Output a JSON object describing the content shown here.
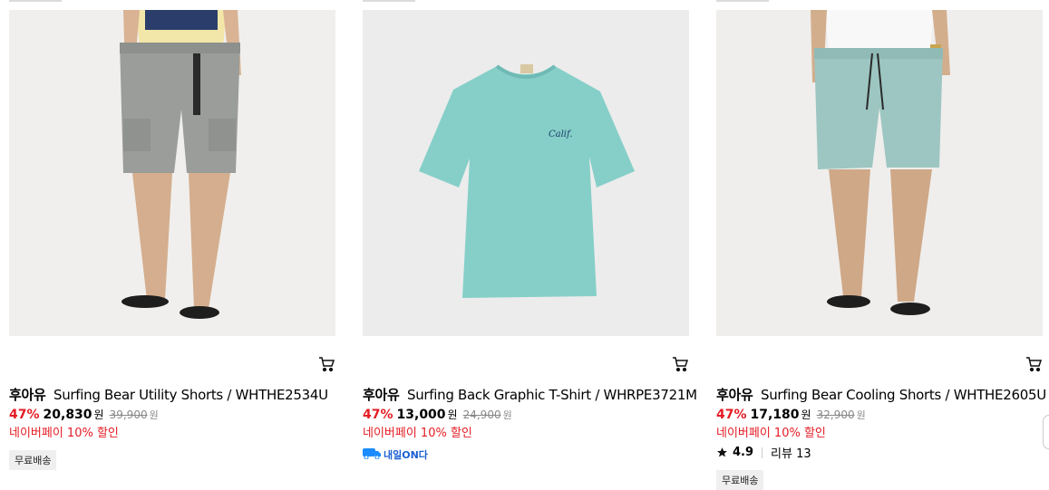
{
  "products": [
    {
      "brand": "후아유",
      "name": "Surfing Bear Utility Shorts / WHTHE2534U",
      "discount": "47%",
      "price": "20,830",
      "currency": "원",
      "original_price": "39,900",
      "original_currency": "원",
      "promo": "네이버페이 10% 할인",
      "tag": "무료배송",
      "cart_icon": "cart-icon"
    },
    {
      "brand": "후아유",
      "name": "Surfing Back Graphic T-Shirt / WHRPE3721M",
      "discount": "47%",
      "price": "13,000",
      "currency": "원",
      "original_price": "24,900",
      "original_currency": "원",
      "promo": "네이버페이 10% 할인",
      "delivery_badge": "내일ON다",
      "cart_icon": "cart-icon"
    },
    {
      "brand": "후아유",
      "name": "Surfing Bear Cooling Shorts / WHTHE2605U",
      "discount": "47%",
      "price": "17,180",
      "currency": "원",
      "original_price": "32,900",
      "original_currency": "원",
      "promo": "네이버페이 10% 할인",
      "rating": "4.9",
      "review_label": "리뷰 13",
      "tag": "무료배송",
      "cart_icon": "cart-icon"
    }
  ],
  "colors": {
    "discount_red": "#e41b23",
    "delivery_blue": "#1a5fd1",
    "photo_bg": "#ededed"
  }
}
